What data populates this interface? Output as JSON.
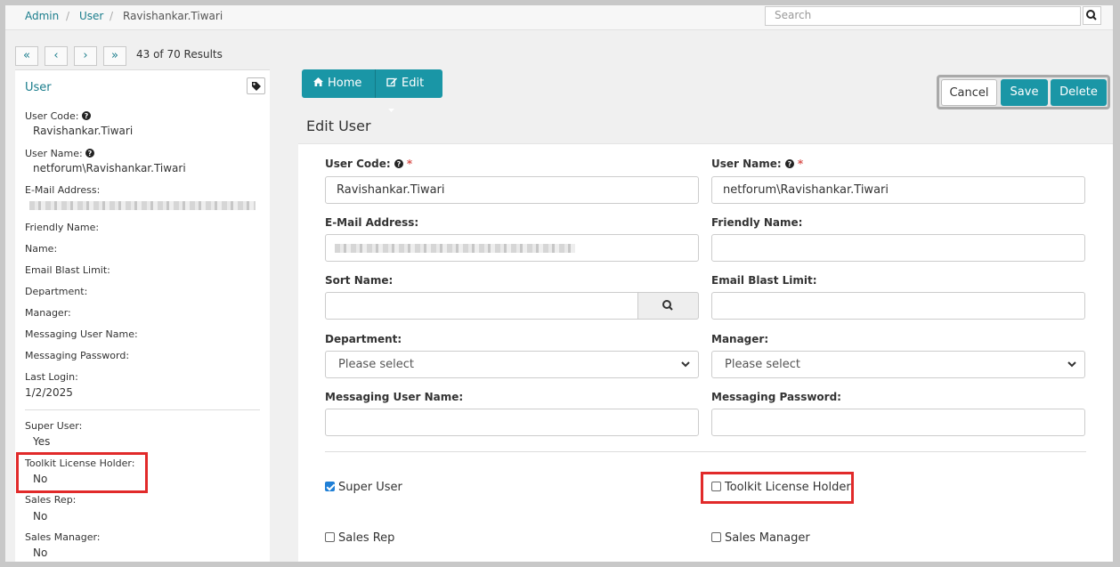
{
  "breadcrumb": {
    "admin": "Admin",
    "user": "User",
    "current": "Ravishankar.Tiwari",
    "separator": "/"
  },
  "search": {
    "placeholder": "Search"
  },
  "pager": {
    "first": "«",
    "prev": "‹",
    "next": "›",
    "last": "»",
    "results": "43 of 70 Results"
  },
  "left_panel": {
    "title": "User",
    "user_code_label": "User Code:",
    "user_code": "Ravishankar.Tiwari",
    "user_name_label": "User Name:",
    "user_name": "netforum\\Ravishankar.Tiwari",
    "email_label": "E-Mail Address:",
    "friendly_name_label": "Friendly Name:",
    "name_label": "Name:",
    "email_blast_label": "Email Blast Limit:",
    "department_label": "Department:",
    "manager_label": "Manager:",
    "messaging_user_label": "Messaging User Name:",
    "messaging_password_label": "Messaging Password:",
    "last_login_label": "Last Login:",
    "last_login": "1/2/2025",
    "super_user_label": "Super User:",
    "super_user": "Yes",
    "toolkit_label": "Toolkit License Holder:",
    "toolkit": "No",
    "sales_rep_label": "Sales Rep:",
    "sales_rep": "No",
    "sales_manager_label": "Sales Manager:",
    "sales_manager": "No"
  },
  "toolbar": {
    "home": "Home",
    "edit": "Edit"
  },
  "actions": {
    "cancel": "Cancel",
    "save": "Save",
    "delete": "Delete"
  },
  "form": {
    "title": "Edit User",
    "user_code_label": "User Code:",
    "user_code_value": "Ravishankar.Tiwari",
    "user_name_label": "User Name:",
    "user_name_value": "netforum\\Ravishankar.Tiwari",
    "email_label": "E-Mail Address:",
    "friendly_name_label": "Friendly Name:",
    "sort_name_label": "Sort Name:",
    "email_blast_label": "Email Blast Limit:",
    "department_label": "Department:",
    "department_value": "Please select",
    "manager_label": "Manager:",
    "manager_value": "Please select",
    "messaging_user_label": "Messaging User Name:",
    "messaging_password_label": "Messaging Password:",
    "required_mark": "*",
    "checkboxes": {
      "super_user": "Super User",
      "toolkit": "Toolkit License Holder",
      "sales_rep": "Sales Rep",
      "sales_manager": "Sales Manager"
    },
    "checked": {
      "super_user": true,
      "toolkit": false,
      "sales_rep": false,
      "sales_manager": false
    }
  },
  "colors": {
    "accent": "#1a96a6",
    "link": "#1a7d8c",
    "highlight": "#e12a2a"
  },
  "icons": [
    "search-icon",
    "tag-icon",
    "home-icon",
    "edit-icon",
    "caret-down-icon",
    "help-icon",
    "chevron-down-icon",
    "checkbox-icon"
  ]
}
